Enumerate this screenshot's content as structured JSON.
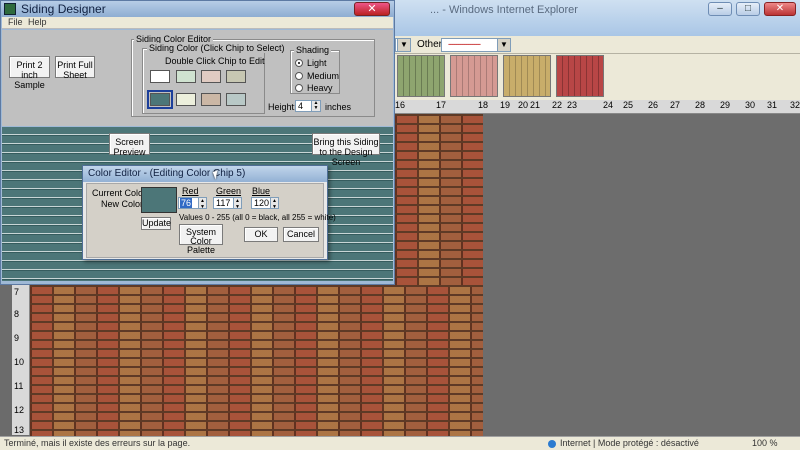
{
  "background": {
    "title": "... - Windows Internet Explorer",
    "toolbar": {
      "dropdown1_value": "",
      "other_label": "Other:",
      "other_value": "----------------"
    },
    "swatch_colors": [
      "#8ea56f",
      "#d59a93",
      "#c8ad6a",
      "#b84646"
    ],
    "ruler_numbers": [
      "16",
      "17",
      "18",
      "19",
      "20",
      "21",
      "22",
      "23",
      "24",
      "25",
      "26",
      "27",
      "28",
      "29",
      "30",
      "31",
      "32"
    ],
    "vertical_ruler": [
      "7",
      "8",
      "9",
      "10",
      "11",
      "12",
      "13"
    ],
    "status": {
      "left": "Terminé, mais il existe des erreurs sur la page.",
      "right": "Internet | Mode protégé : désactivé",
      "zoom": "100 %"
    }
  },
  "siding_designer": {
    "title": "Siding Designer",
    "menu": [
      "File",
      "Help"
    ],
    "print_sample_label": "Print 2 inch Sample",
    "print_sheet_label": "Print Full Sheet",
    "editor_group_label": "Siding Color Editor",
    "color_group_label": "Siding Color (Click Chip to Select)",
    "double_click_hint": "Double Click Chip to Edit",
    "chips": [
      "#ffffff",
      "#cfe2d0",
      "#e0cbc2",
      "#c7c7b2",
      "#4c7678",
      "#ecefdc",
      "#cbb7a5",
      "#b8c8c6"
    ],
    "selected_chip": 5,
    "shading_label": "Shading",
    "shading_options": [
      "Light",
      "Medium",
      "Heavy"
    ],
    "shading_selected": "Light",
    "height_label": "Height:",
    "height_value": "4",
    "height_unit": "inches",
    "screen_preview_label": "Screen Preview",
    "bring_siding_label": "Bring this Siding to the Design Screen"
  },
  "color_editor": {
    "title": "Color Editor - (Editing Color Chip 5)",
    "current_color_label": "Current Color:",
    "new_color_label": "New Color:",
    "update_label": "Update",
    "red_label": "Red",
    "green_label": "Green",
    "blue_label": "Blue",
    "red_value": "76",
    "green_value": "117",
    "blue_value": "120",
    "range_hint": "Values 0 - 255 (all 0 = black, all 255 = white)",
    "system_palette_label": "System Color Palette",
    "ok_label": "OK",
    "cancel_label": "Cancel",
    "current_color": "#4c7678"
  }
}
